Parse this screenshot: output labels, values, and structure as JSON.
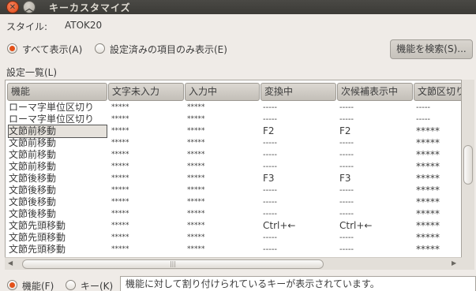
{
  "window": {
    "title": "キーカスタマイズ"
  },
  "style": {
    "label": "スタイル:",
    "value": "ATOK20"
  },
  "filter": {
    "show_all_label": "すべて表示(A)",
    "show_configured_label": "設定済みの項目のみ表示(E)",
    "selected": "show_all"
  },
  "search_button_label": "機能を検索(S)...",
  "list": {
    "label": "設定一覧(L)",
    "columns": [
      "機能",
      "文字未入力",
      "入力中",
      "変換中",
      "次候補表示中",
      "文節区切り"
    ],
    "rows": [
      [
        "ローマ字単位区切り",
        "*****",
        "*****",
        "-----",
        "-----",
        "-----"
      ],
      [
        "ローマ字単位区切り",
        "*****",
        "*****",
        "-----",
        "-----",
        "-----"
      ],
      [
        "文節前移動",
        "*****",
        "*****",
        "F2",
        "F2",
        "*****"
      ],
      [
        "文節前移動",
        "*****",
        "*****",
        "-----",
        "-----",
        "*****"
      ],
      [
        "文節前移動",
        "*****",
        "*****",
        "-----",
        "-----",
        "*****"
      ],
      [
        "文節前移動",
        "*****",
        "*****",
        "-----",
        "-----",
        "*****"
      ],
      [
        "文節後移動",
        "*****",
        "*****",
        "F3",
        "F3",
        "*****"
      ],
      [
        "文節後移動",
        "*****",
        "*****",
        "-----",
        "-----",
        "*****"
      ],
      [
        "文節後移動",
        "*****",
        "*****",
        "-----",
        "-----",
        "*****"
      ],
      [
        "文節後移動",
        "*****",
        "*****",
        "-----",
        "-----",
        "*****"
      ],
      [
        "文節先頭移動",
        "*****",
        "*****",
        "Ctrl+←",
        "Ctrl+←",
        "*****"
      ],
      [
        "文節先頭移動",
        "*****",
        "*****",
        "-----",
        "-----",
        "*****"
      ],
      [
        "文節先頭移動",
        "*****",
        "*****",
        "-----",
        "-----",
        "*****"
      ]
    ],
    "selected_row": 2
  },
  "bottom": {
    "function_label": "機能(F)",
    "key_label": "キー(K)",
    "selected": "function",
    "status_text": "機能に対して割り付けられているキーが表示されています。"
  }
}
